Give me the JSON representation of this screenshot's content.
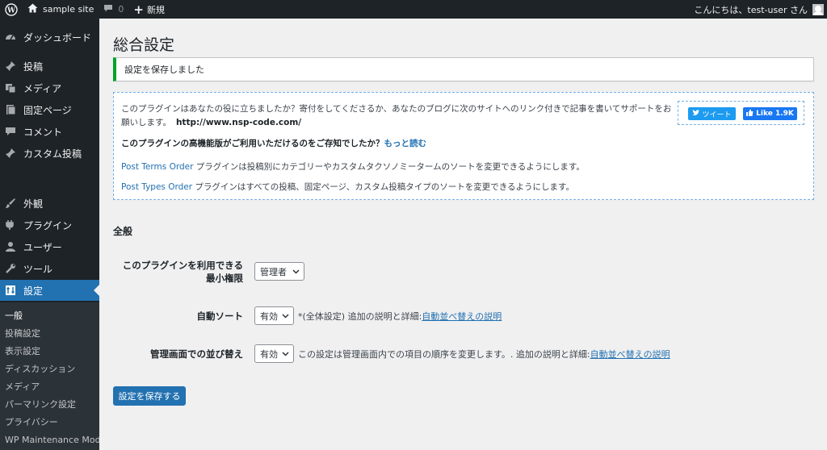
{
  "adminbar": {
    "site_name": "sample site",
    "comments_count": "0",
    "new_label": "新規",
    "greeting": "こんにちは、test-user さん"
  },
  "sidebar": {
    "items": [
      {
        "label": "ダッシュボード",
        "icon": "dashboard-icon"
      },
      {
        "label": "投稿",
        "icon": "pin-icon"
      },
      {
        "label": "メディア",
        "icon": "media-icon"
      },
      {
        "label": "固定ページ",
        "icon": "page-icon"
      },
      {
        "label": "コメント",
        "icon": "comment-icon"
      },
      {
        "label": "カスタム投稿",
        "icon": "pin-icon"
      },
      {
        "label": "外観",
        "icon": "brush-icon"
      },
      {
        "label": "プラグイン",
        "icon": "plugin-icon"
      },
      {
        "label": "ユーザー",
        "icon": "user-icon"
      },
      {
        "label": "ツール",
        "icon": "wrench-icon"
      },
      {
        "label": "設定",
        "icon": "settings-icon"
      }
    ],
    "submenu": [
      "一般",
      "投稿設定",
      "表示設定",
      "ディスカッション",
      "メディア",
      "パーマリンク設定",
      "プライバシー",
      "WP Maintenance Mode"
    ]
  },
  "main": {
    "title": "総合設定",
    "notice": "設定を保存しました",
    "promo": {
      "text1": "このプラグインはあなたの役に立ちましたか？寄付をしてくださるか、あなたのブログに次のサイトへのリンク付きで記事を書いてサポートをお願いします。",
      "url": "http://www.nsp-code.com/",
      "pro_text": "このプラグインの高機能版がご利用いただけるのをご存知でしたか？",
      "pro_link": "もっと読む",
      "line3_link": "Post Terms Order",
      "line3_text": " プラグインは投稿別にカテゴリーやカスタムタクソノミータームのソートを変更できるようにします。",
      "line4_link": "Post Types Order",
      "line4_text": " プラグインはすべての投稿、固定ページ、カスタム投稿タイプのソートを変更できるようにします。",
      "tweet_label": "ツイート",
      "like_label": "Like 1.9K"
    },
    "section_title": "全般",
    "fields": {
      "min_level_label": "このプラグインを利用できる最小権限",
      "min_level_value": "管理者",
      "autosort_label": "自動ソート",
      "autosort_value": "有効",
      "autosort_desc": "*(全体設定) 追加の説明と詳細:",
      "autosort_link": "自動並べ替えの説明",
      "admin_sort_label": "管理画面での並び替え",
      "admin_sort_value": "有効",
      "admin_sort_desc": "この設定は管理画面内での項目の順序を変更します。. 追加の説明と詳細:",
      "admin_sort_link": "自動並べ替えの説明"
    },
    "save_label": "設定を保存する"
  },
  "colors": {
    "accent": "#2271b1",
    "admin_dark": "#1d2327",
    "success": "#00a32a"
  }
}
